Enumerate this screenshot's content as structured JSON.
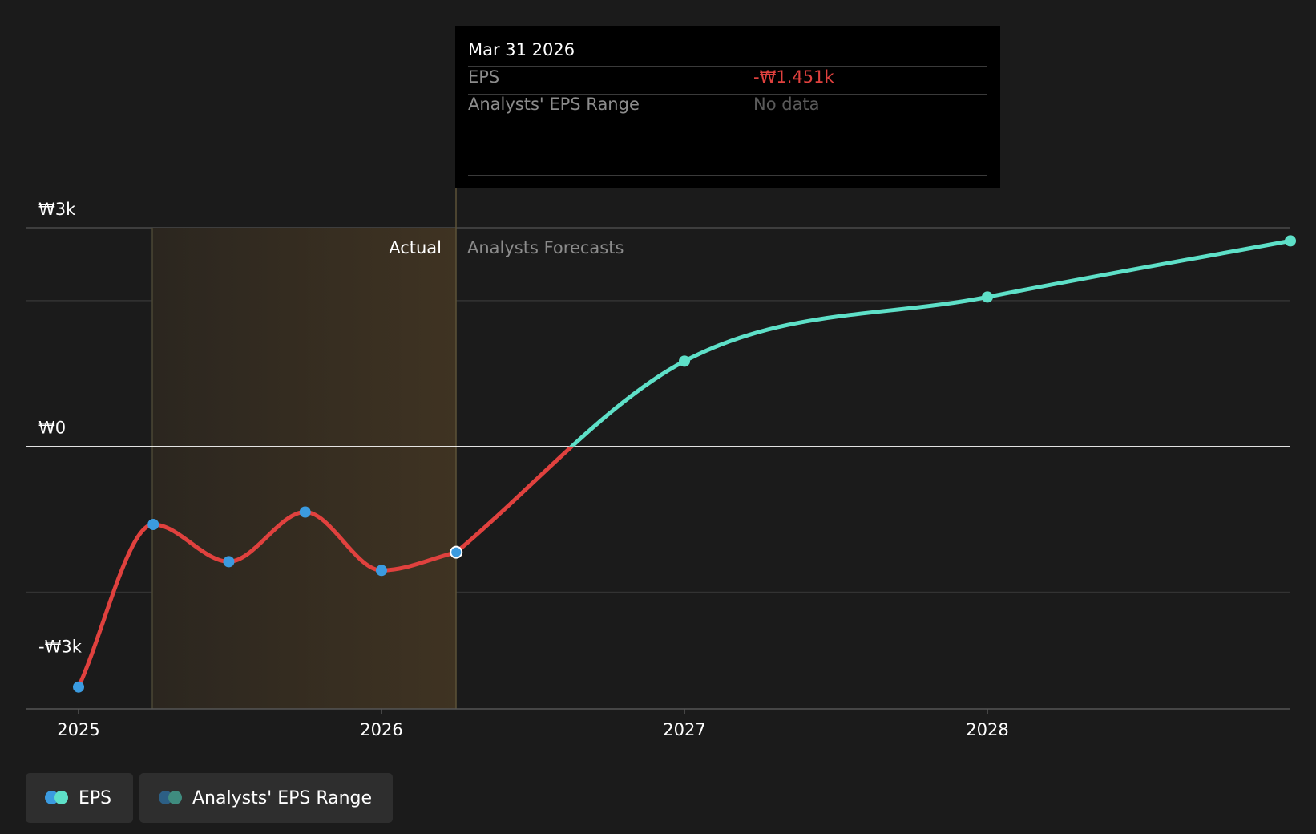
{
  "chart_data": {
    "type": "line",
    "y_ticks": [
      "₩3k",
      "₩0",
      "-₩3k"
    ],
    "x_ticks": [
      "2025",
      "2026",
      "2027",
      "2028"
    ],
    "regions": {
      "actual_label": "Actual",
      "forecast_label": "Analysts Forecasts"
    },
    "series": [
      {
        "name": "EPS",
        "x": [
          "2025-01-01",
          "2025-04-01",
          "2025-07-01",
          "2025-10-01",
          "2026-01-01",
          "2026-04-01"
        ],
        "values": [
          -3300,
          -1070,
          -1580,
          -900,
          -1700,
          -1451
        ]
      },
      {
        "name": "EPS",
        "x": [
          "2026-04-01",
          "2027-01-01",
          "2028-01-01",
          "2028-12-31"
        ],
        "values": [
          -1451,
          1170,
          2050,
          2820
        ]
      }
    ],
    "ylim": [
      -3600,
      3000
    ],
    "colors": {
      "negative": "#e0413e",
      "forecast": "#5ee0c8",
      "actual_point": "#3b9be0",
      "zero_line": "#ffffff",
      "actual_band": "#3f3322"
    }
  },
  "tooltip": {
    "date": "Mar 31 2026",
    "rows": [
      {
        "label": "EPS",
        "value": "-₩1.451k",
        "color": "#e0413e"
      },
      {
        "label": "Analysts' EPS Range",
        "value": "No data",
        "color": "#5a5a5a"
      }
    ]
  },
  "legend": [
    {
      "label": "EPS",
      "colors": [
        "#3b9be0",
        "#5ee0c8"
      ]
    },
    {
      "label": "Analysts' EPS Range",
      "colors": [
        "#2c5f85",
        "#3f8c7f"
      ]
    }
  ]
}
